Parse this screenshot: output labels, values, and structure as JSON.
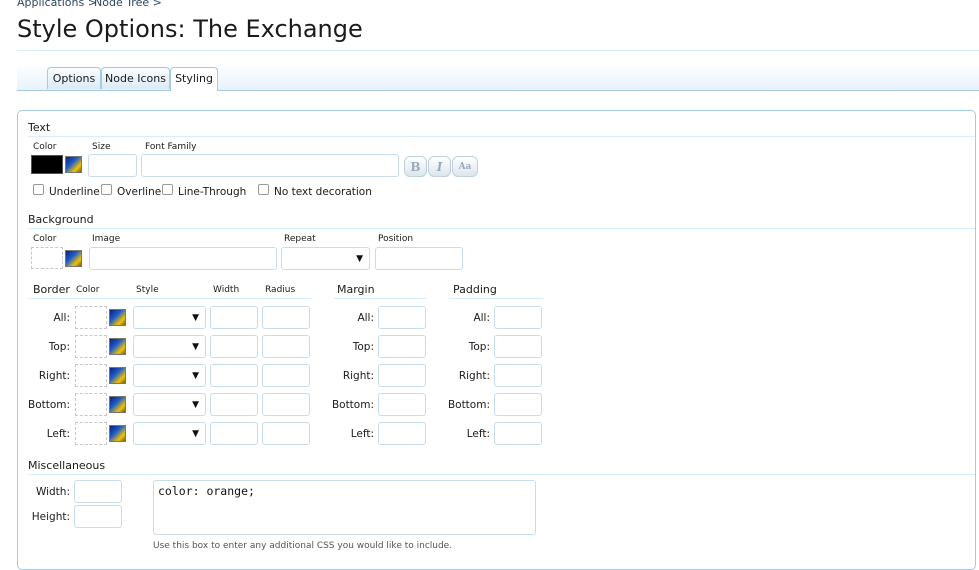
{
  "breadcrumb": [
    "Applications >",
    "Node Tree >"
  ],
  "page_title": "Style Options: The Exchange",
  "tabs": [
    "Options",
    "Node Icons",
    "Styling"
  ],
  "active_tab": "Styling",
  "text_section": {
    "heading": "Text",
    "color_label": "Color",
    "size_label": "Size",
    "font_family_label": "Font Family",
    "size_value": "",
    "font_family_value": "",
    "color_value": "#000000",
    "bold_glyph": "B",
    "italic_glyph": "I",
    "caps_glyph": "Aa",
    "decorations": [
      "Underline",
      "Overline",
      "Line-Through",
      "No text decoration"
    ]
  },
  "background_section": {
    "heading": "Background",
    "color_label": "Color",
    "image_label": "Image",
    "repeat_label": "Repeat",
    "position_label": "Position"
  },
  "border_section": {
    "heading": "Border",
    "col_color": "Color",
    "col_style": "Style",
    "col_width": "Width",
    "col_radius": "Radius",
    "rows": [
      "All:",
      "Top:",
      "Right:",
      "Bottom:",
      "Left:"
    ]
  },
  "margin_section": {
    "heading": "Margin",
    "rows": [
      "All:",
      "Top:",
      "Right:",
      "Bottom:",
      "Left:"
    ]
  },
  "padding_section": {
    "heading": "Padding",
    "rows": [
      "All:",
      "Top:",
      "Right:",
      "Bottom:",
      "Left:"
    ]
  },
  "misc_section": {
    "heading": "Miscellaneous",
    "width_label": "Width:",
    "height_label": "Height:",
    "css_value": "color: orange;",
    "hint": "Use this box to enter any additional CSS you would like to include."
  },
  "colors": {
    "accent_border": "#a5cae4",
    "section_rule": "#d7edfc",
    "link": "#2b485c"
  }
}
